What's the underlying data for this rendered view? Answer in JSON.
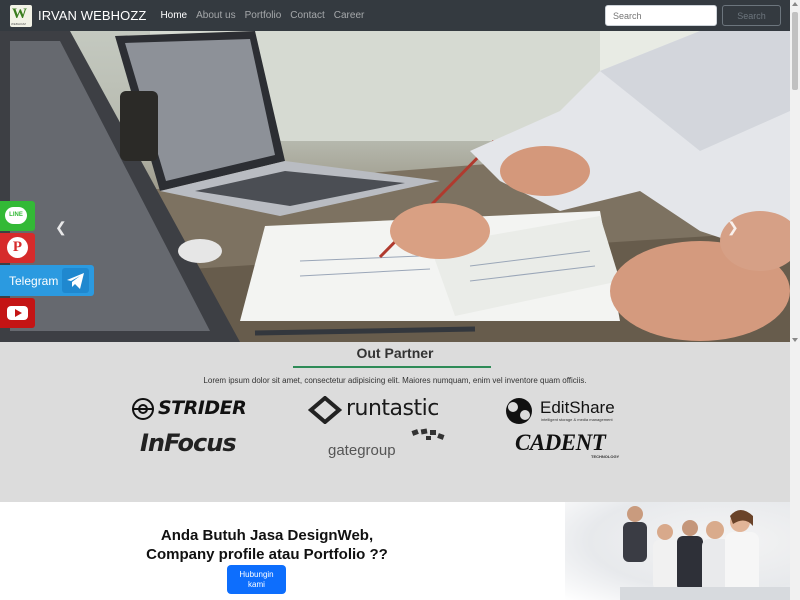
{
  "brand": {
    "name": "IRVAN WEBHOZZ",
    "logo_icon": "webhozz-logo"
  },
  "nav": {
    "items": [
      "Home",
      "About us",
      "Portfolio",
      "Contact",
      "Career"
    ],
    "active": "Home"
  },
  "search": {
    "placeholder": "Search",
    "button_label": "Search"
  },
  "hero": {
    "prev_icon": "chevron-left-icon",
    "next_icon": "chevron-right-icon"
  },
  "social": {
    "line": "LINE",
    "pinterest_icon": "pinterest-icon",
    "telegram": "Telegram",
    "youtube_icon": "youtube-icon"
  },
  "partner": {
    "title": "Out Partner",
    "description": "Lorem ipsum dolor sit amet, consectetur adipisicing elit. Maiores numquam, enim vel inventore quam officiis.",
    "logos": {
      "strider": "STRIDER",
      "runtastic": "runtastic",
      "editshare": "EditShare",
      "editshare_tagline": "intelligent storage & media management",
      "infocus": "InFocus",
      "gategroup": "gategroup",
      "cadent": "CADENT",
      "cadent_sub": "TECHNOLOGY"
    }
  },
  "cta": {
    "title_line1": "Anda Butuh Jasa DesignWeb,",
    "title_line2": "Company profile atau Portfolio ??",
    "button_line1": "Hubungin",
    "button_line2": "kami"
  },
  "colors": {
    "navbar": "#343a40",
    "line": "#33b936",
    "pinterest": "#d62b2b",
    "telegram": "#2b9ae0",
    "youtube": "#c41414",
    "partner_bg": "#dcdcdc",
    "partner_underline": "#2e8b57",
    "cta_button": "#0d6efd"
  }
}
